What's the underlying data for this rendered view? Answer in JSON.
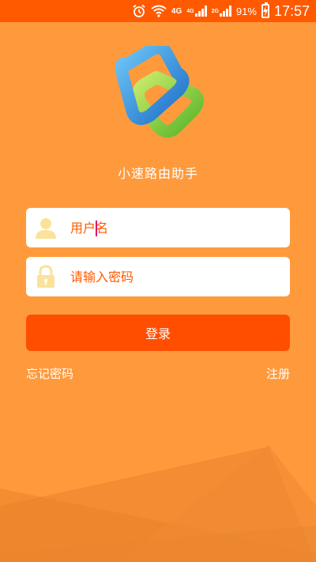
{
  "status_bar": {
    "network_4g_label": "4G",
    "signal1_label": "4G",
    "signal2_label": "2G",
    "battery_text": "91%",
    "time": "17:57"
  },
  "app": {
    "name": "小速路由助手"
  },
  "form": {
    "username_placeholder": "用户名",
    "username_value": "",
    "password_placeholder": "请输入密码",
    "password_value": "",
    "login_label": "登录",
    "forgot_label": "忘记密码",
    "register_label": "注册"
  },
  "colors": {
    "background": "#FF9A3C",
    "status_bar": "#FF5A00",
    "primary_button": "#FF4E00",
    "placeholder": "#FF5A00",
    "icon_yellow": "#FBE29B"
  }
}
